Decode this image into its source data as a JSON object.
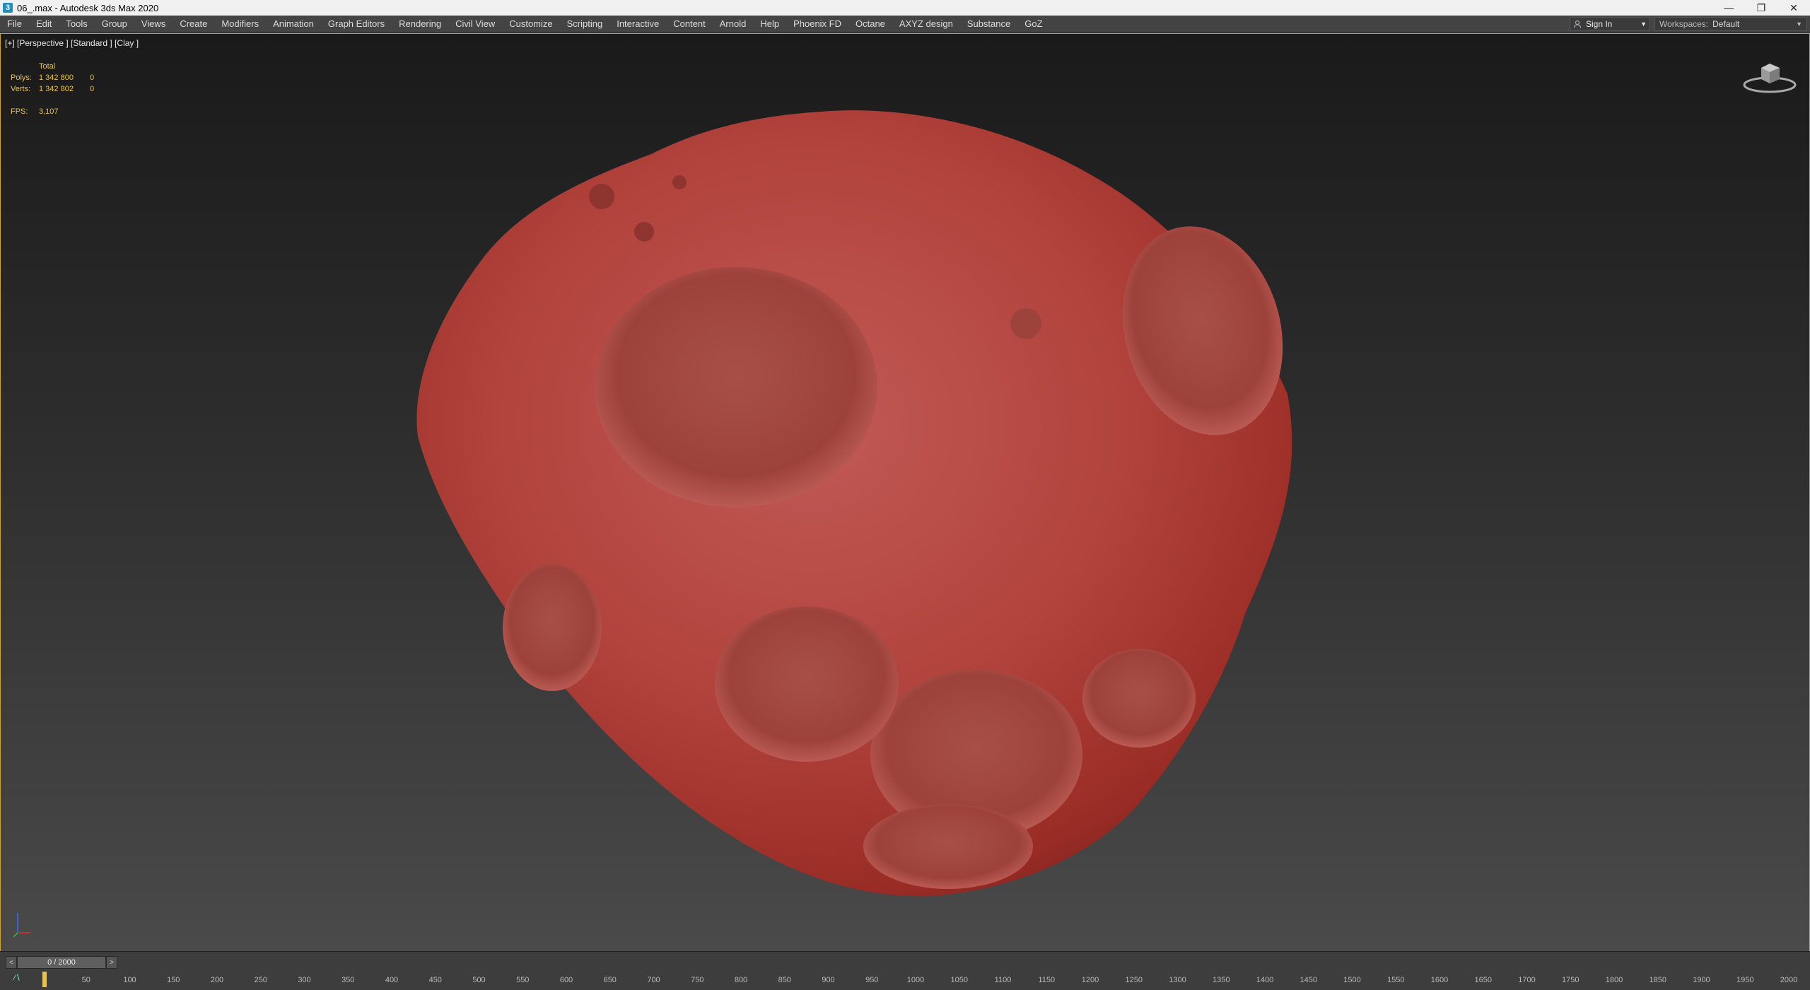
{
  "window": {
    "title": "06_.max - Autodesk 3ds Max 2020",
    "app_icon": "3",
    "controls": [
      "minimize-icon",
      "restore-icon",
      "close-icon"
    ]
  },
  "menu": {
    "items": [
      "File",
      "Edit",
      "Tools",
      "Group",
      "Views",
      "Create",
      "Modifiers",
      "Animation",
      "Graph Editors",
      "Rendering",
      "Civil View",
      "Customize",
      "Scripting",
      "Interactive",
      "Content",
      "Arnold",
      "Help",
      "Phoenix FD",
      "Octane",
      "AXYZ design",
      "Substance",
      "GoZ"
    ],
    "sign_in": "Sign In",
    "workspaces_label": "Workspaces:",
    "workspaces_value": "Default"
  },
  "viewport": {
    "label": "[+] [Perspective ] [Standard ] [Clay ]",
    "stats": {
      "total_label": "Total",
      "polys_label": "Polys:",
      "polys_total": "1 342 800",
      "polys_sel": "0",
      "verts_label": "Verts:",
      "verts_total": "1 342 802",
      "verts_sel": "0",
      "fps_label": "FPS:",
      "fps_value": "3,107"
    },
    "object_color": "#b8413a"
  },
  "timeline": {
    "frame_display": "0 / 2000",
    "prev": "<",
    "next": ">",
    "track_toggle": "⁄∖",
    "ticks": [
      "0",
      "50",
      "100",
      "150",
      "200",
      "250",
      "300",
      "350",
      "400",
      "450",
      "500",
      "550",
      "600",
      "650",
      "700",
      "750",
      "800",
      "850",
      "900",
      "950",
      "1000",
      "1050",
      "1100",
      "1150",
      "1200",
      "1250",
      "1300",
      "1350",
      "1400",
      "1450",
      "1500",
      "1550",
      "1600",
      "1650",
      "1700",
      "1750",
      "1800",
      "1850",
      "1900",
      "1950",
      "2000"
    ]
  }
}
